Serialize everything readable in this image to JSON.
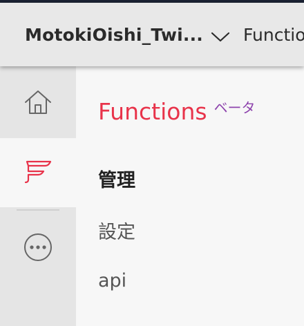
{
  "header": {
    "account_name": "MotokiOishi_Twi...",
    "breadcrumb": "Functio"
  },
  "sidebar": {
    "items": [
      {
        "name": "home",
        "icon": "home-icon"
      },
      {
        "name": "functions",
        "icon": "functions-icon",
        "active": true
      },
      {
        "name": "more",
        "icon": "more-icon"
      }
    ],
    "active_color": "#e8334a"
  },
  "main": {
    "title": "Functions",
    "badge": "ベータ",
    "menu": [
      "管理",
      "設定",
      "api"
    ]
  },
  "colors": {
    "accent": "#e8334a",
    "badge": "#8e44ad",
    "header_bg": "#e8e8e8",
    "sidebar_bg": "#e5e5e5",
    "content_bg": "#f7f7f7"
  }
}
